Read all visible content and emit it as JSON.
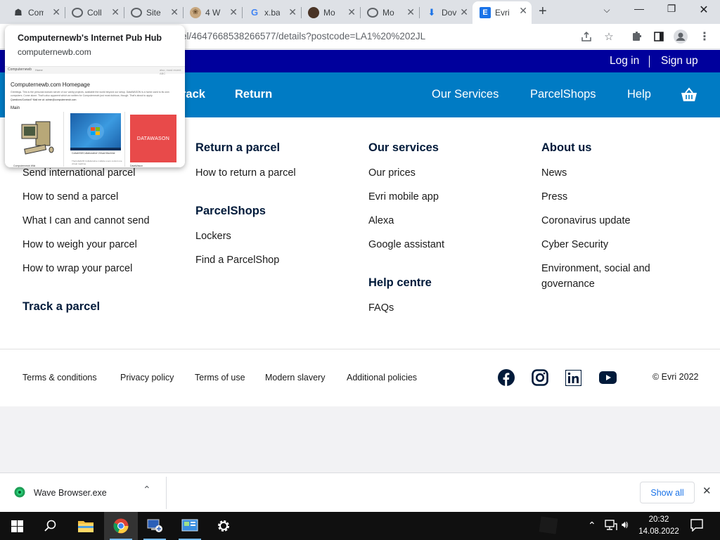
{
  "browser": {
    "tabs": [
      {
        "title": "Com",
        "color": "#3c4043",
        "glyph": "☗"
      },
      {
        "title": "Coll",
        "color": "#5f6368",
        "glyph": "◍"
      },
      {
        "title": "Site",
        "color": "#5f6368",
        "glyph": "◍"
      },
      {
        "title": "4 W",
        "color": "#a08060",
        "glyph": "❀"
      },
      {
        "title": "x.ba",
        "color": "#4285f4",
        "glyph": "G"
      },
      {
        "title": "Mo",
        "color": "#5a4030",
        "glyph": "●"
      },
      {
        "title": "Mo",
        "color": "#5f6368",
        "glyph": "◍"
      },
      {
        "title": "Dov",
        "color": "#1a73e8",
        "glyph": "⬇"
      },
      {
        "title": "Evri",
        "color": "#1a73e8",
        "glyph": "E"
      }
    ],
    "url": "el/4647668538266577/details?postcode=LA1%20%202JL"
  },
  "hover_card": {
    "title": "Computernewb's Internet Pub Hub",
    "domain": "computernewb.com",
    "thumb": {
      "site_name": "Computernewb",
      "nav": "Home",
      "nav_right": "also, most recent ABC",
      "heading": "Computernewb.com Homepage",
      "intro": "Greetings. This is the personal domain server of our vanity projects, available the world beyond our setup. DataWASON is a home used to its own computers. Come alone. That's also apparent which an written for Computernewb just most dubious, though. That's about to apply.",
      "contact": "Questions/Contact? Mail me at: admin@computernewb.com",
      "main": "Main",
      "captions": [
        "Computernewb Wiki",
        "CollabVM/Collaborative Virtual Machine",
        "DataWason"
      ],
      "caption_sub": "TheCollabVM Collaborative multiple users control one virtual machine",
      "datawason_label": "DATAWASON"
    }
  },
  "site": {
    "top_links": {
      "login": "Log in",
      "signup": "Sign up"
    },
    "nav": {
      "track": "rack",
      "return": "Return",
      "services": "Our Services",
      "parcelshops": "ParcelShops",
      "help": "Help"
    },
    "col1": {
      "links": [
        "Send international parcel",
        "How to send a parcel",
        "What I can and cannot send",
        "How to weigh your parcel",
        "How to wrap your parcel"
      ],
      "heading2": "Track a parcel"
    },
    "col2": {
      "heading": "Return a parcel",
      "links": [
        "How to return a parcel"
      ],
      "heading2": "ParcelShops",
      "links2": [
        "Lockers",
        "Find a ParcelShop"
      ]
    },
    "col3": {
      "heading": "Our services",
      "links": [
        "Our prices",
        "Evri mobile app",
        "Alexa",
        "Google assistant"
      ],
      "heading2": "Help centre",
      "links2": [
        "FAQs"
      ]
    },
    "col4": {
      "heading": "About us",
      "links": [
        "News",
        "Press",
        "Coronavirus update",
        "Cyber Security"
      ],
      "esg_line1": "Environment, social and",
      "esg_line2": "governance"
    },
    "footer": {
      "links": [
        "Terms & conditions",
        "Privacy policy",
        "Terms of use",
        "Modern slavery",
        "Additional policies"
      ],
      "copyright": "© Evri 2022"
    }
  },
  "downloads": {
    "file": "Wave Browser.exe",
    "show_all": "Show all"
  },
  "taskbar": {
    "time": "20:32",
    "date": "14.08.2022"
  },
  "colors": {
    "brand_dark": "#00009c",
    "brand_blue": "#007bc4"
  }
}
